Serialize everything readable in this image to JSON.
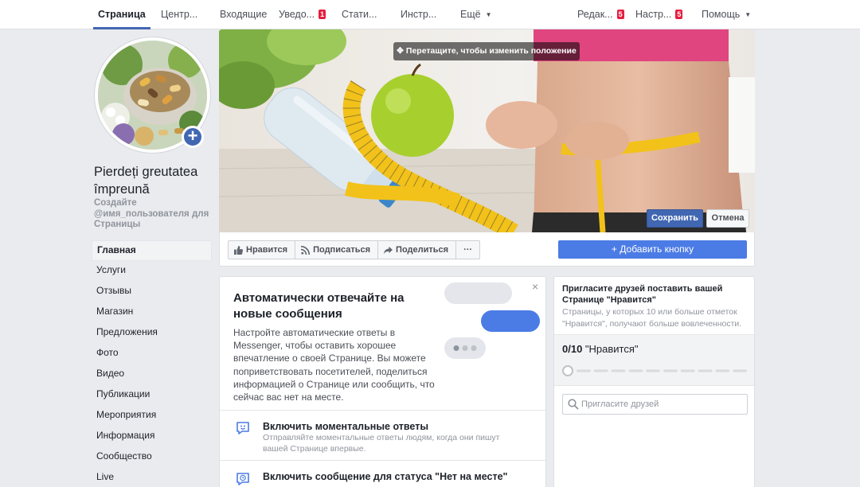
{
  "nav": {
    "items": [
      {
        "label": "Страница",
        "badge": ""
      },
      {
        "label": "Центр...",
        "badge": ""
      },
      {
        "label": "Входящие",
        "badge": ""
      },
      {
        "label": "Уведо...",
        "badge": "1"
      },
      {
        "label": "Стати...",
        "badge": ""
      },
      {
        "label": "Инстр...",
        "badge": ""
      },
      {
        "label": "Ещё",
        "badge": ""
      }
    ],
    "right_items": [
      {
        "label": "Редак...",
        "badge": "5"
      },
      {
        "label": "Настр...",
        "badge": "5"
      },
      {
        "label": "Помощь",
        "badge": ""
      }
    ]
  },
  "page": {
    "name": "Pierdeți greutatea împreună",
    "username_link": "Создайте @имя_пользователя для Страницы"
  },
  "sidebar": {
    "items": [
      {
        "label": "Главная",
        "active": true
      },
      {
        "label": "Услуги"
      },
      {
        "label": "Отзывы"
      },
      {
        "label": "Магазин"
      },
      {
        "label": "Предложения"
      },
      {
        "label": "Фото"
      },
      {
        "label": "Видео"
      },
      {
        "label": "Публикации"
      },
      {
        "label": "Мероприятия"
      },
      {
        "label": "Информация"
      },
      {
        "label": "Сообщество"
      },
      {
        "label": "Live"
      }
    ]
  },
  "cover": {
    "drag_hint": "Перетащите, чтобы изменить положение",
    "save": "Сохранить",
    "cancel": "Отмена"
  },
  "actions": {
    "like": "Нравится",
    "follow": "Подписаться",
    "share": "Поделиться",
    "more": "···",
    "add_button": "Добавить кнопку"
  },
  "messenger": {
    "title": "Автоматически отвечайте на новые сообщения",
    "body": "Настройте автоматические ответы в Messenger, чтобы оставить хорошее впечатление о своей Странице. Вы можете поприветствовать посетителей, поделиться информацией о Странице или сообщить, что сейчас вас нет на месте.",
    "close": "×",
    "rows": [
      {
        "title": "Включить моментальные ответы",
        "desc": "Отправляйте моментальные ответы людям, когда они пишут вашей Странице впервые."
      },
      {
        "title": "Включить сообщение для статуса \"Нет на месте\"",
        "desc": ""
      }
    ]
  },
  "invite": {
    "title": "Пригласите друзей поставить вашей Странице \"Нравится\"",
    "desc": "Страницы, у которых 10 или больше отметок \"Нравится\", получают больше вовлеченности.",
    "count": "0/10",
    "count_label": " \"Нравится\"",
    "likes_current": 0,
    "likes_goal": 10,
    "search_placeholder": "Пригласите друзей"
  },
  "colors": {
    "brand_blue": "#4267b2",
    "badge_red": "#e41e3f",
    "add_button_blue": "#4b7be5"
  }
}
